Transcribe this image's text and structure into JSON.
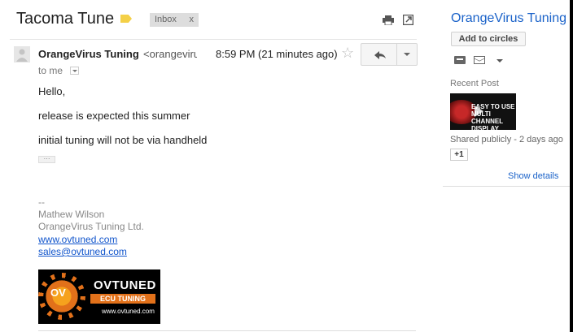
{
  "thread": {
    "subject": "Tacoma Tune",
    "label_color": "#f4d047",
    "inbox_chip": {
      "label": "Inbox",
      "remove": "x"
    },
    "icons": [
      "print-icon",
      "new-window-icon"
    ]
  },
  "message": {
    "sender_name": "OrangeVirus Tuning",
    "sender_email": "<orangeviru",
    "time": "8:59 PM (21 minutes ago)",
    "to": "to me",
    "icons": [
      "star-icon",
      "reply-icon",
      "more-options-icon"
    ],
    "body": [
      "Hello,",
      "release is expected this summer",
      "initial tuning will not be via handheld"
    ],
    "trimmed_content_button": "···",
    "signature": {
      "dash": "--",
      "name": "Mathew Wilson",
      "company": "OrangeVirus Tuning Ltd.",
      "website": "www.ovtuned.com",
      "email": "sales@ovtuned.com"
    },
    "logo": {
      "brand": "OVTUNED",
      "tagline": "ECU TUNING",
      "url": "www.ovtuned.com",
      "monogram": "OV",
      "accent": "#e2711a"
    }
  },
  "profile_panel": {
    "name": "OrangeVirus Tuning",
    "add_button": "Add to circles",
    "icons": [
      "contact-card-icon",
      "mail-icon",
      "chevron-down-icon"
    ],
    "recent_post_heading": "Recent Post",
    "recent_post_thumbnail_text": "EASY TO USE MULTI CHANNEL DISPLAY",
    "shared": "Shared publicly - 2 days ago",
    "plus_one": "+1",
    "show_details": "Show details",
    "link_color": "#1a62c9"
  }
}
